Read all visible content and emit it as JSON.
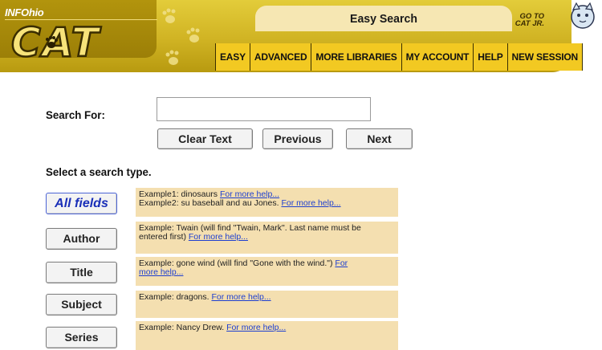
{
  "header": {
    "brand_small": "INFOhio",
    "brand_logo": "CAT",
    "title": "Easy Search",
    "goto_line1": "GO TO",
    "goto_line2": "CAT JR."
  },
  "nav": {
    "items": [
      {
        "label": "EASY"
      },
      {
        "label": "ADVANCED"
      },
      {
        "label": "MORE LIBRARIES"
      },
      {
        "label": "MY ACCOUNT"
      },
      {
        "label": "HELP"
      },
      {
        "label": "NEW SESSION"
      }
    ]
  },
  "search": {
    "label": "Search For:",
    "value": "",
    "placeholder": ""
  },
  "buttons": {
    "clear": "Clear Text",
    "previous": "Previous",
    "next": "Next"
  },
  "select_type_label": "Select a search type.",
  "search_types": [
    {
      "label": "All fields",
      "line1": "Example1: dinosaurs ",
      "link1": "For more help...",
      "line2": "Example2: su baseball and au Jones. ",
      "link2": "For more help..."
    },
    {
      "label": "Author",
      "line1": "Example:  Twain (will find \"Twain, Mark\". Last name must be",
      "line2": "entered first) ",
      "link": "For more help..."
    },
    {
      "label": "Title",
      "line1": "Example: gone wind (will find \"Gone with the wind.\") ",
      "link_a": "For",
      "link_b": "more help..."
    },
    {
      "label": "Subject",
      "text": "Example: dragons. ",
      "link": "For more help..."
    },
    {
      "label": "Series",
      "text": "Example: Nancy Drew. ",
      "link": "For more help..."
    }
  ],
  "colors": {
    "header_gold": "#d0b323",
    "nav_yellow": "#f2c922",
    "help_bg": "#f4dfb0",
    "link_blue": "#1e3fd0",
    "active_blue": "#1a2fb8"
  }
}
